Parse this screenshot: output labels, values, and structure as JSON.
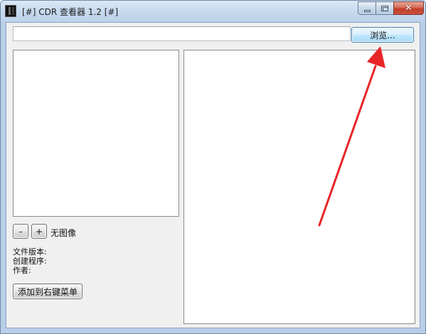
{
  "window": {
    "title": "[#] CDR 查看器 1.2 [#]",
    "controls": {
      "minimize_icon": "minimize-icon",
      "maximize_icon": "maximize-icon",
      "close_icon": "close-icon",
      "close_glyph": "✕"
    }
  },
  "toolbar": {
    "path_value": "",
    "path_placeholder": "",
    "browse_label": "浏览..."
  },
  "preview": {
    "zoom_out_label": "-",
    "zoom_in_label": "+",
    "status": "无图像"
  },
  "info": {
    "file_version_label": "文件版本:",
    "creator_label": "创建程序:",
    "author_label": "作者:"
  },
  "actions": {
    "context_menu_label": "添加到右键菜单"
  },
  "annotation": {
    "arrow_color": "#e8262a"
  },
  "colors": {
    "browse_button_border": "#3c7fb1",
    "close_button": "#c1402a",
    "titlebar": "#c5d8ee"
  }
}
